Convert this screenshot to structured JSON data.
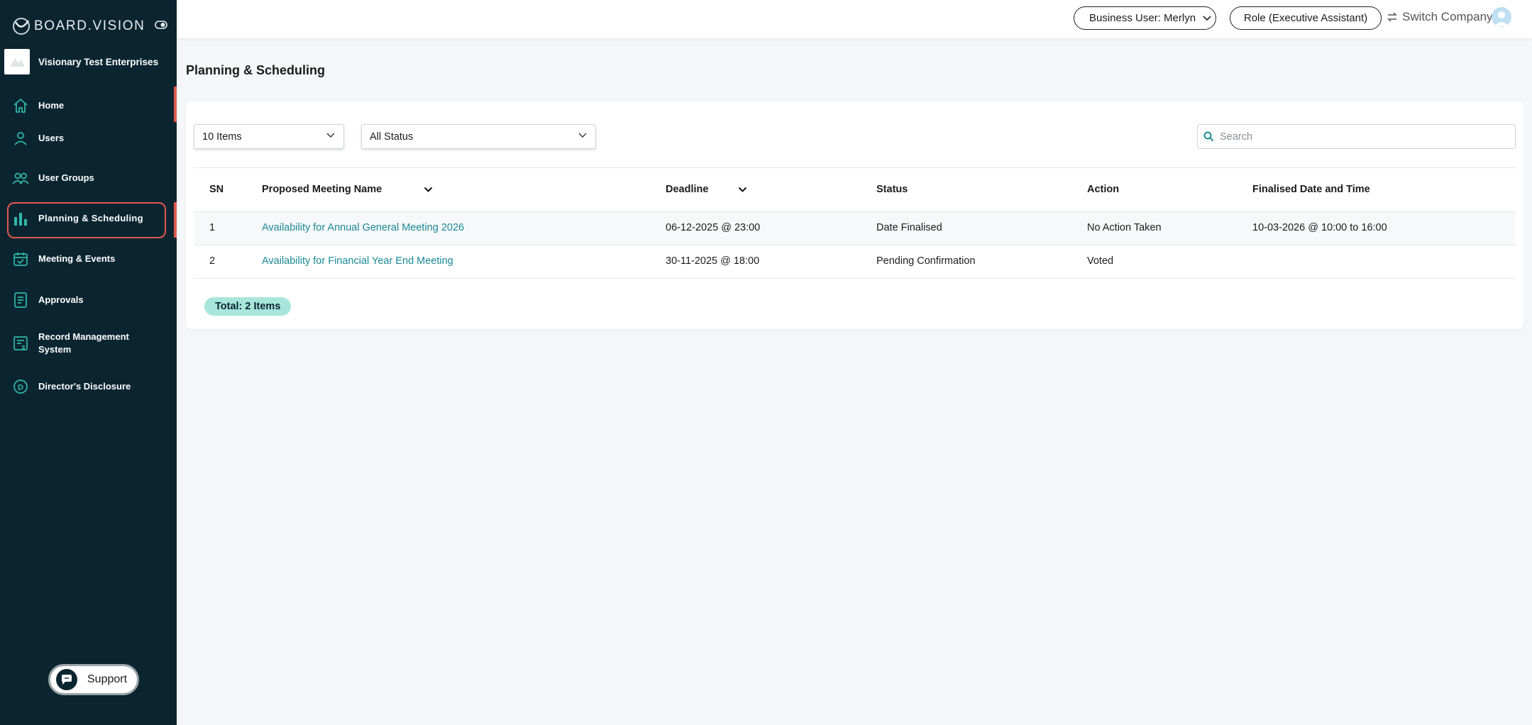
{
  "brand": {
    "name": "BOARD.VISION"
  },
  "company": {
    "name": "Visionary Test Enterprises"
  },
  "sidebar": {
    "items": [
      {
        "label": "Home",
        "icon": "home-icon"
      },
      {
        "label": "Users",
        "icon": "user-icon"
      },
      {
        "label": "User Groups",
        "icon": "user-group-icon"
      },
      {
        "label": "Planning & Scheduling",
        "icon": "bar-chart-icon",
        "selected": true
      },
      {
        "label": "Meeting & Events",
        "icon": "calendar-icon"
      },
      {
        "label": "Approvals",
        "icon": "document-icon"
      },
      {
        "label": "Record Management System",
        "icon": "records-icon"
      },
      {
        "label": "Director's Disclosure",
        "icon": "d-circle-icon"
      }
    ],
    "support_label": "Support"
  },
  "topbar": {
    "business_user": "Business User: Merlyn",
    "role": "Role (Executive Assistant)",
    "switch_company": "Switch Company"
  },
  "page": {
    "title": "Planning & Scheduling"
  },
  "filters": {
    "items_per_page": "10 Items",
    "status": "All Status",
    "search_placeholder": "Search"
  },
  "table": {
    "headers": {
      "sn": "SN",
      "name": "Proposed Meeting Name",
      "deadline": "Deadline",
      "status": "Status",
      "action": "Action",
      "finalised": "Finalised Date and Time"
    },
    "rows": [
      {
        "sn": "1",
        "name": "Availability for Annual General Meeting 2026",
        "deadline": "06-12-2025 @ 23:00",
        "status": "Date Finalised",
        "action": "No Action Taken",
        "finalised": "10-03-2026 @ 10:00 to 16:00"
      },
      {
        "sn": "2",
        "name": "Availability for Financial Year End Meeting",
        "deadline": "30-11-2025 @ 18:00",
        "status": "Pending Confirmation",
        "action": "Voted",
        "finalised": ""
      }
    ]
  },
  "total": "Total: 2 Items",
  "colors": {
    "sidebar_bg": "#0b2530",
    "accent_teal": "#1b8a96",
    "highlight_red": "#e2574c",
    "badge_bg": "#a8e6dc"
  }
}
